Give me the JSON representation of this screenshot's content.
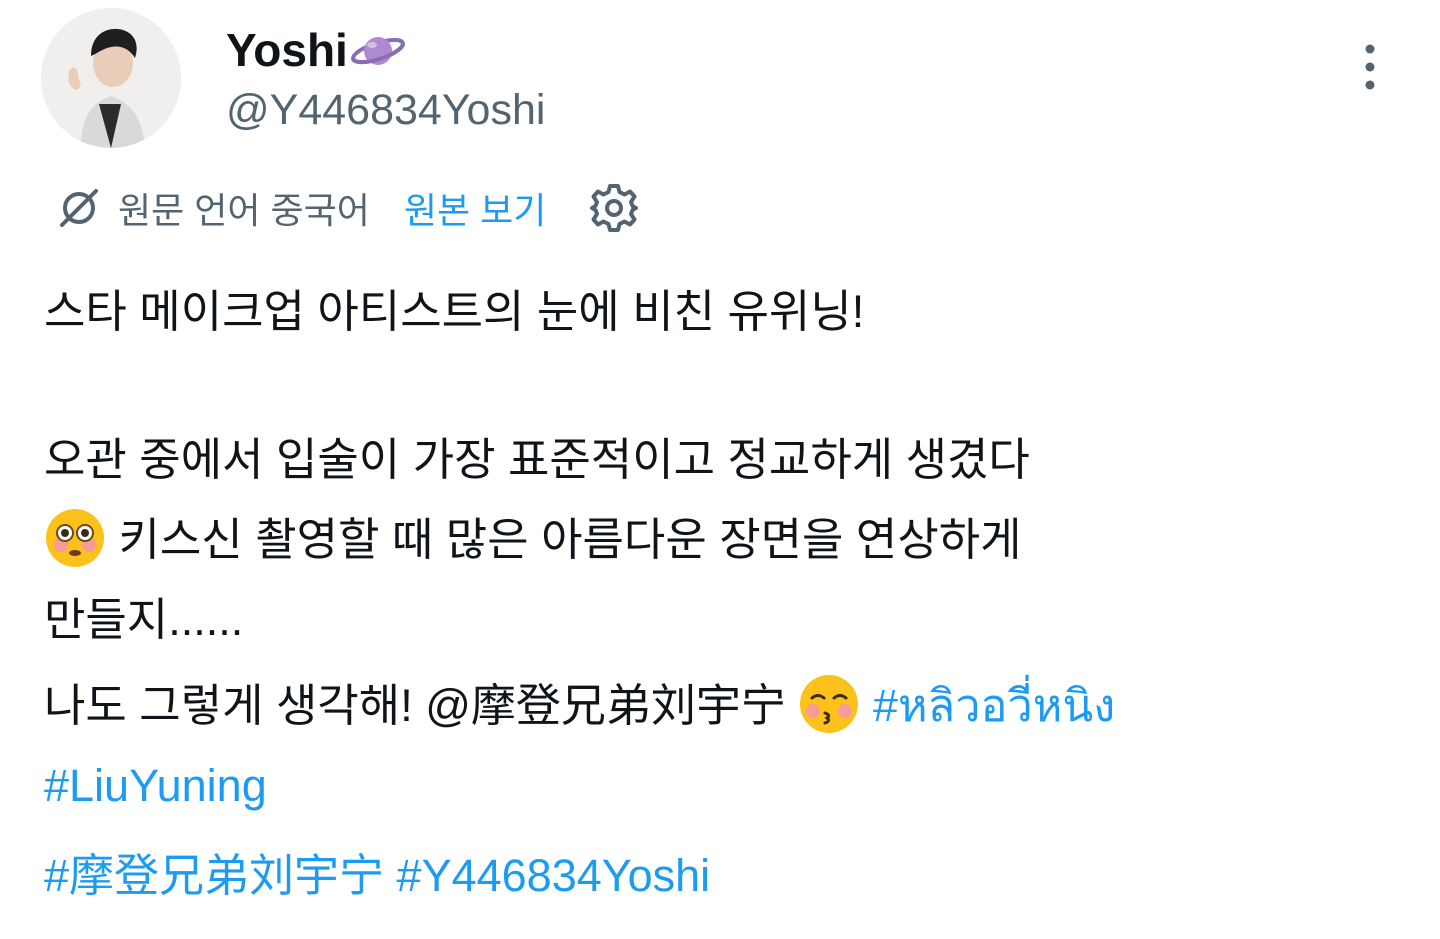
{
  "user": {
    "display_name": "Yoshi",
    "handle": "@Y446834Yoshi",
    "name_emoji": "planet"
  },
  "translation": {
    "original_language_label": "원문 언어 중국어",
    "show_original_label": "원본 보기"
  },
  "tweet": {
    "line1": "스타 메이크업 아티스트의 눈에 비친 유위닝!",
    "line2": "오관 중에서 입술이 가장 표준적이고 정교하게 생겼다",
    "line3_emoji": "flushed-face",
    "line3": " 키스신 촬영할 때 많은 아름다운 장면을 연상하게",
    "line4": "만들지......",
    "line5_prefix": "나도 그렇게 생각해! ",
    "mention": "@摩登兄弟刘宇宁",
    "line5_emoji": "kissing-face-closed-eyes",
    "hashtag_thai": "#หลิวอวี่หนิง",
    "hashtag_liuyuning": "#LiuYuning",
    "hashtag_chinese": "#摩登兄弟刘宇宁",
    "hashtag_handle": "#Y446834Yoshi"
  },
  "colors": {
    "text": "#0f1419",
    "secondary": "#536471",
    "link": "#1d9bf0"
  }
}
